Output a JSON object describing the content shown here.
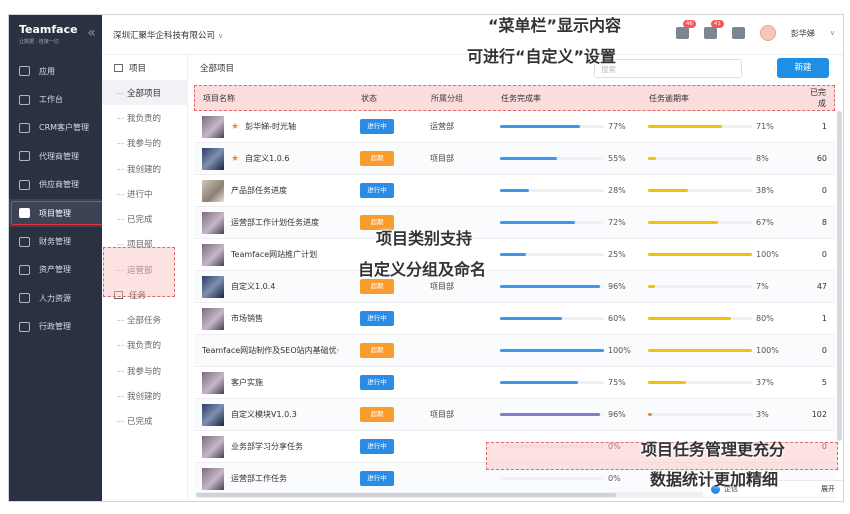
{
  "sidebar": {
    "brand": "Teamface",
    "slogan": "让数据 · 连接一切",
    "collapse_icon": "«",
    "items": [
      {
        "label": "应用",
        "icon": "apps-icon"
      },
      {
        "label": "工作台",
        "icon": "desktop-icon"
      },
      {
        "label": "CRM客户管理",
        "icon": "crm-icon"
      },
      {
        "label": "代理商管理",
        "icon": "agent-icon"
      },
      {
        "label": "供应商管理",
        "icon": "supplier-icon"
      },
      {
        "label": "项目管理",
        "icon": "project-icon",
        "active": true
      },
      {
        "label": "财务管理",
        "icon": "finance-icon"
      },
      {
        "label": "资产管理",
        "icon": "asset-icon"
      },
      {
        "label": "人力资源",
        "icon": "hr-icon"
      },
      {
        "label": "行政管理",
        "icon": "admin-icon"
      }
    ]
  },
  "topbar": {
    "company": "深圳汇聚华企科技有限公司",
    "mail_badge": "46",
    "bell_badge": "41",
    "username": "彭华娣"
  },
  "subnav": {
    "project_header": "项目",
    "project_items": [
      "全部项目",
      "我负责的",
      "我参与的",
      "我创建的",
      "进行中",
      "已完成",
      "项目部",
      "运营部"
    ],
    "task_header": "任务",
    "task_items": [
      "全部任务",
      "我负责的",
      "我参与的",
      "我创建的",
      "已完成"
    ]
  },
  "main": {
    "crumb": "全部项目",
    "search_placeholder": "搜索",
    "new_button": "新建",
    "columns": [
      "项目名称",
      "状态",
      "所属分组",
      "任务完成率",
      "任务逾期率",
      "已完成"
    ],
    "rows": [
      {
        "name": "彭华娣-时光轴",
        "star": true,
        "status": "进行中",
        "status_type": "run",
        "group": "运营部",
        "completion": 77,
        "completion_text": "77%",
        "overdue": 71,
        "overdue_text": "71%",
        "done": "1",
        "thumb": "t1"
      },
      {
        "name": "自定义1.0.6",
        "star": true,
        "status": "超期",
        "status_type": "over",
        "group": "项目部",
        "completion": 55,
        "completion_text": "55%",
        "overdue": 8,
        "overdue_text": "8%",
        "done": "60",
        "thumb": "t2"
      },
      {
        "name": "产品部任务进度",
        "star": false,
        "status": "进行中",
        "status_type": "run",
        "group": "",
        "completion": 28,
        "completion_text": "28%",
        "overdue": 38,
        "overdue_text": "38%",
        "done": "0",
        "thumb": "t3"
      },
      {
        "name": "运营部工作计划任务进度",
        "star": false,
        "status": "超期",
        "status_type": "over",
        "group": "",
        "completion": 72,
        "completion_text": "72%",
        "overdue": 67,
        "overdue_text": "67%",
        "done": "8",
        "thumb": "t1"
      },
      {
        "name": "Teamface网站推广计划",
        "star": false,
        "status": "",
        "status_type": "",
        "group": "",
        "completion": 25,
        "completion_text": "25%",
        "overdue": 100,
        "overdue_text": "100%",
        "done": "0",
        "thumb": "t1"
      },
      {
        "name": "自定义1.0.4",
        "star": false,
        "status": "超期",
        "status_type": "over",
        "group": "项目部",
        "completion": 96,
        "completion_text": "96%",
        "overdue": 7,
        "overdue_text": "7%",
        "done": "47",
        "thumb": "t2"
      },
      {
        "name": "市场销售",
        "star": false,
        "status": "进行中",
        "status_type": "run",
        "group": "",
        "completion": 60,
        "completion_text": "60%",
        "overdue": 80,
        "overdue_text": "80%",
        "done": "1",
        "thumb": "t1"
      },
      {
        "name": "Teamface网站制作及SEO站内基础优·",
        "star": false,
        "status": "超期",
        "status_type": "over",
        "group": "",
        "completion": 100,
        "completion_text": "100%",
        "overdue": 100,
        "overdue_text": "100%",
        "done": "0",
        "thumb": ""
      },
      {
        "name": "客户实施",
        "star": false,
        "status": "进行中",
        "status_type": "run",
        "group": "",
        "completion": 75,
        "completion_text": "75%",
        "overdue": 37,
        "overdue_text": "37%",
        "done": "5",
        "thumb": "t1"
      },
      {
        "name": "自定义模块V1.0.3",
        "star": false,
        "status": "超期",
        "status_type": "over",
        "group": "项目部",
        "completion": 96,
        "completion_text": "96%",
        "overdue": 3,
        "overdue_text": "3%",
        "done": "102",
        "thumb": "t2",
        "highlight": true
      },
      {
        "name": "业务部学习分享任务",
        "star": false,
        "status": "进行中",
        "status_type": "run",
        "group": "",
        "completion": 0,
        "completion_text": "0%",
        "overdue": 0,
        "overdue_text": "",
        "done": "0",
        "thumb": "t1"
      },
      {
        "name": "运营部工作任务",
        "star": false,
        "status": "进行中",
        "status_type": "run",
        "group": "",
        "completion": 0,
        "completion_text": "0%",
        "overdue": 0,
        "overdue_text": "",
        "done": "",
        "thumb": "t1"
      }
    ]
  },
  "float": {
    "label": "企信",
    "expand": "展开"
  },
  "annotations": {
    "a1_line1": "“菜单栏”显示内容",
    "a1_line2": "可进行“自定义”设置",
    "a2_line1": "项目类别支持",
    "a2_line2": "自定义分组及命名",
    "a3_line1": "项目任务管理更充分",
    "a3_line2": "数据统计更加精细"
  }
}
